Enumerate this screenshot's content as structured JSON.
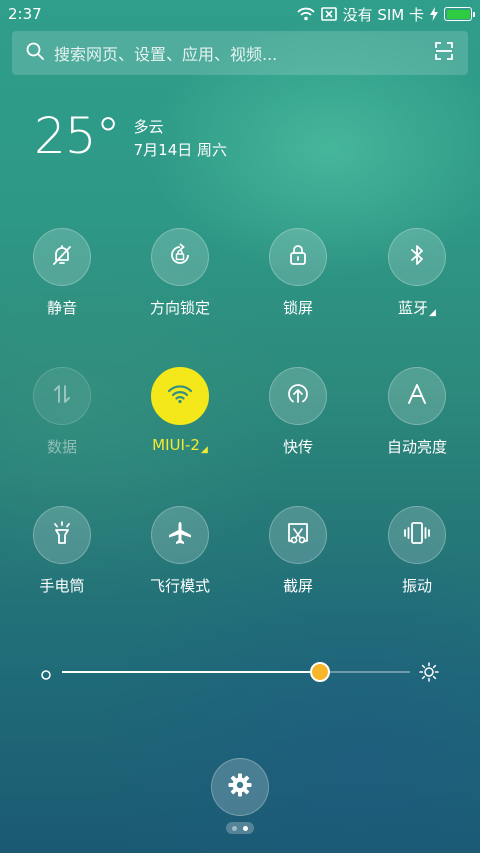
{
  "status_bar": {
    "time": "2:37",
    "carrier": "没有 SIM 卡",
    "battery_level": 1.0
  },
  "search": {
    "placeholder": "搜索网页、设置、应用、视频..."
  },
  "weather": {
    "temperature": "25°",
    "condition": "多云",
    "date": "7月14日 周六"
  },
  "toggles": [
    {
      "label": "静音",
      "icon": "bell-off-icon",
      "state": "off"
    },
    {
      "label": "方向锁定",
      "icon": "rotation-lock-icon",
      "state": "off"
    },
    {
      "label": "锁屏",
      "icon": "lock-icon",
      "state": "off"
    },
    {
      "label": "蓝牙",
      "icon": "bluetooth-icon",
      "state": "off",
      "has_menu": true
    },
    {
      "label": "数据",
      "icon": "mobile-data-icon",
      "state": "disabled"
    },
    {
      "label": "MIUI-2",
      "icon": "wifi-icon",
      "state": "on",
      "has_menu": true
    },
    {
      "label": "快传",
      "icon": "fast-transfer-icon",
      "state": "off"
    },
    {
      "label": "自动亮度",
      "icon": "auto-brightness-icon",
      "state": "off"
    },
    {
      "label": "手电筒",
      "icon": "flashlight-icon",
      "state": "off"
    },
    {
      "label": "飞行模式",
      "icon": "airplane-icon",
      "state": "off"
    },
    {
      "label": "截屏",
      "icon": "screenshot-icon",
      "state": "off"
    },
    {
      "label": "振动",
      "icon": "vibrate-icon",
      "state": "off"
    }
  ],
  "brightness": {
    "level": 0.74
  },
  "colors": {
    "active_toggle": "#f5e81a",
    "active_label": "#f3ea33",
    "slider_thumb": "#f5b62a",
    "battery": "#2ecc40"
  },
  "page_indicator": {
    "count": 2,
    "active_index": 1
  }
}
